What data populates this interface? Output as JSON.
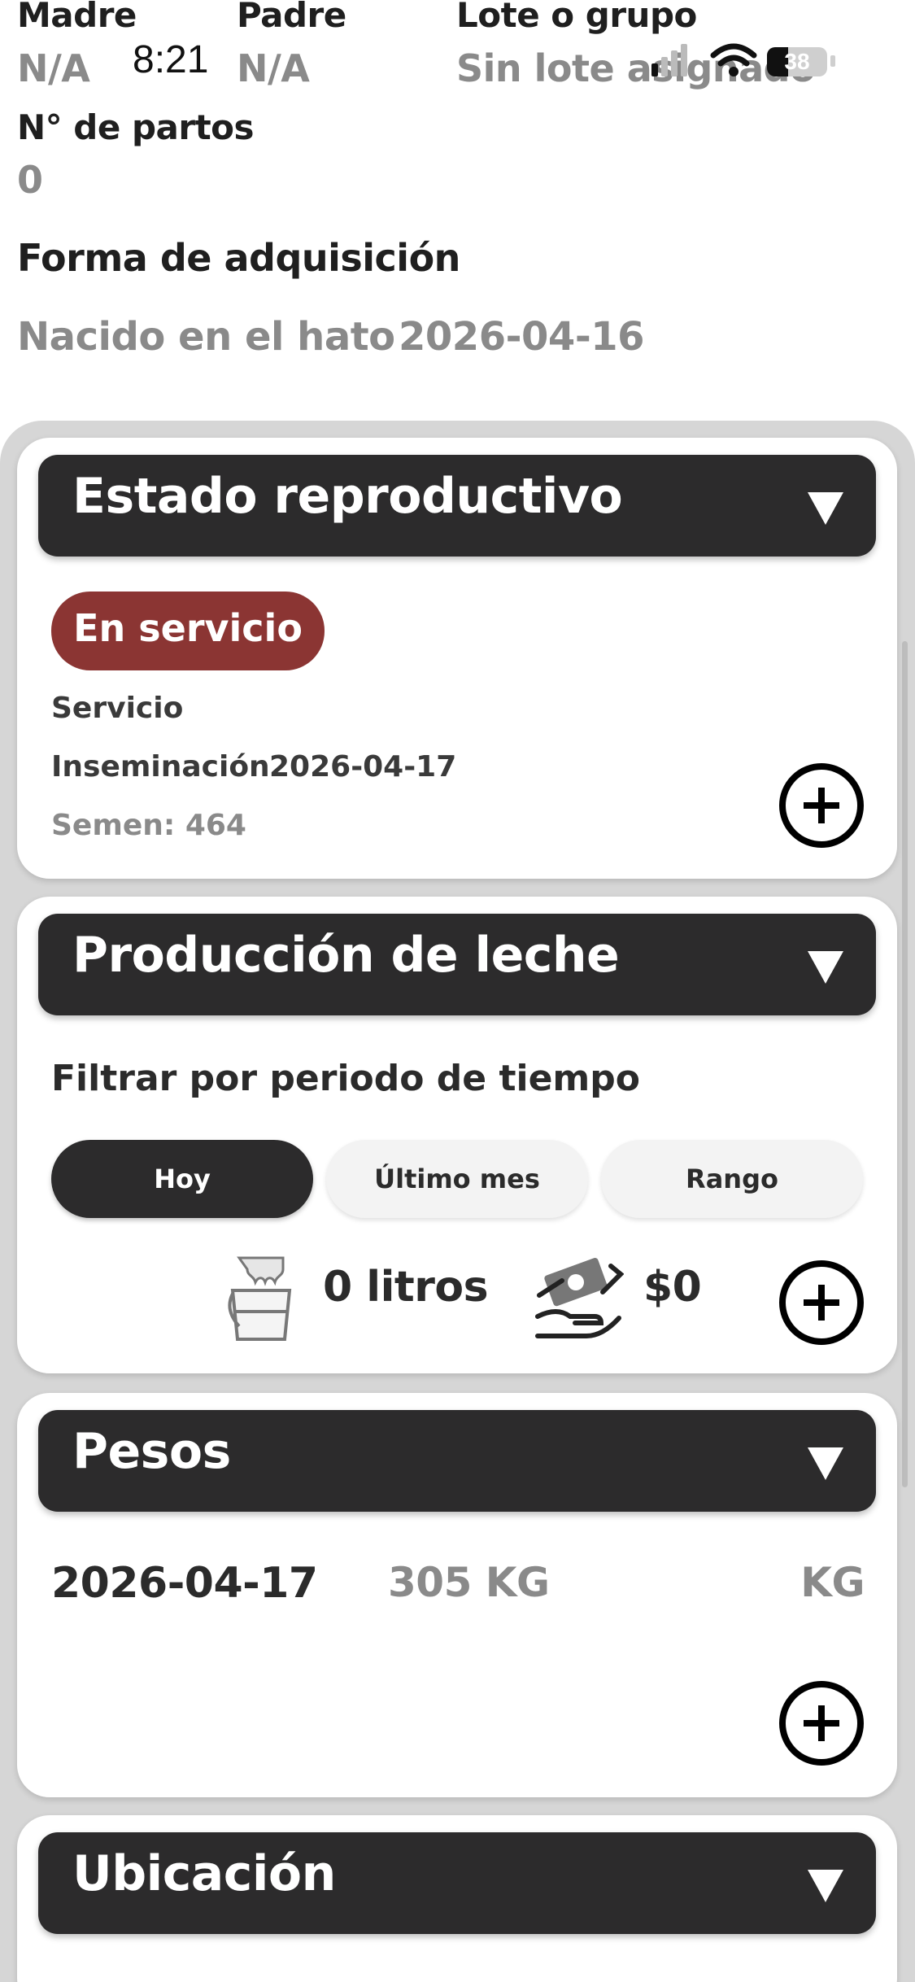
{
  "status_bar": {
    "time": "8:21",
    "battery": "38"
  },
  "top_info": {
    "madre_label": "Madre",
    "madre_value": "N/A",
    "padre_label": "Padre",
    "padre_value": "N/A",
    "lote_label": "Lote o grupo",
    "lote_value": "Sin lote asignado",
    "partos_label": "N° de partos",
    "partos_value": "0",
    "adquisicion_label": "Forma de adquisición",
    "adquisicion_value": "Nacido en el hato",
    "adquisicion_date": "2026-04-16"
  },
  "reproductive": {
    "title": "Estado reproductivo",
    "badge": "En servicio",
    "badge_color": "#8b3533",
    "service_label": "Servicio",
    "insemination_label": "Inseminación",
    "insemination_date": "2026-04-17",
    "semen_text": "Semen: 464"
  },
  "milk": {
    "title": "Producción de leche",
    "filter_label": "Filtrar por periodo de tiempo",
    "filters": [
      "Hoy",
      "Último mes",
      "Rango"
    ],
    "active_filter": "Hoy",
    "liters": "0 litros",
    "money": "$0",
    "icons": [
      "milk-bucket-icon",
      "money-hand-icon"
    ]
  },
  "weights": {
    "title": "Pesos",
    "date": "2026-04-17",
    "weight": "305 KG",
    "unit": "KG"
  },
  "location": {
    "title": "Ubicación"
  },
  "colors": {
    "header_dark": "#2c2b2c",
    "panel_bg": "#d6d6d6",
    "muted_text": "#8a8a8a"
  }
}
